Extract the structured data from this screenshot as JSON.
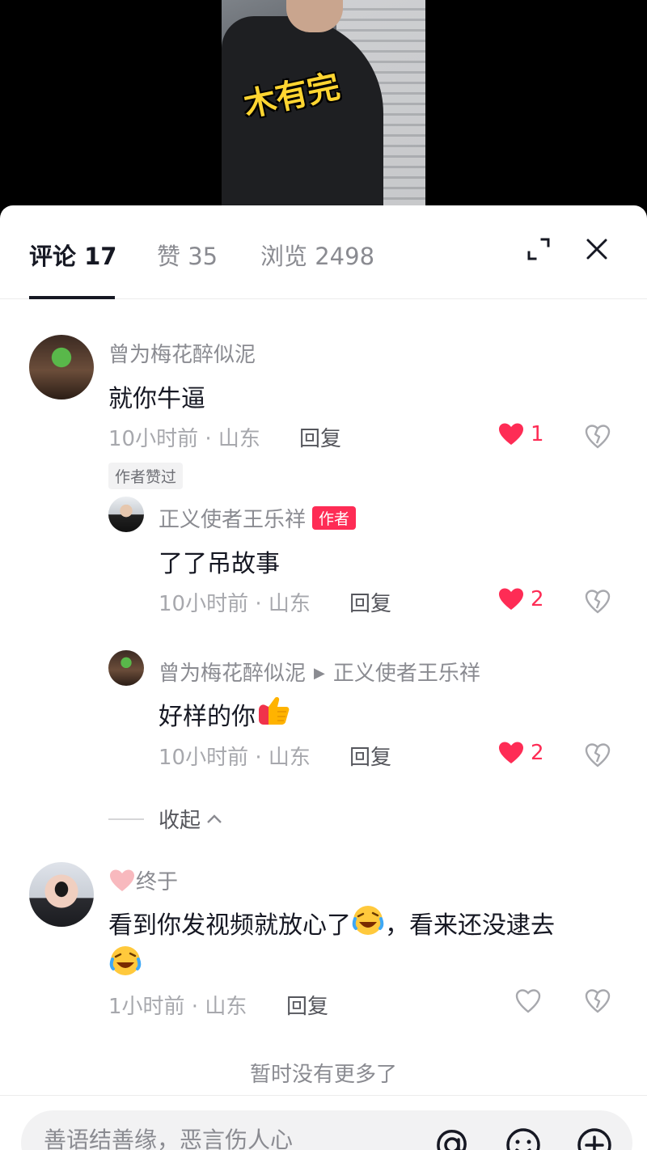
{
  "video": {
    "caption": "木有完"
  },
  "tabs": [
    {
      "label": "评论 17"
    },
    {
      "label": "赞 35"
    },
    {
      "label": "浏览 2498"
    }
  ],
  "comments": [
    {
      "username": "曾为梅花醉似泥",
      "text": "就你牛逼",
      "time_location": "10小时前 · 山东",
      "reply_label": "回复",
      "likes": "1",
      "liked": true,
      "badge": "作者赞过",
      "replies": [
        {
          "username": "正义使者王乐祥",
          "author_badge": "作者",
          "text": "了了吊故事",
          "time_location": "10小时前 · 山东",
          "reply_label": "回复",
          "likes": "2",
          "liked": true
        },
        {
          "username": "曾为梅花醉似泥",
          "reply_to": "正义使者王乐祥",
          "text": "好样的你",
          "emoji": "thumbs-up",
          "time_location": "10小时前 · 山东",
          "reply_label": "回复",
          "likes": "2",
          "liked": true
        }
      ],
      "collapse_label": "收起"
    },
    {
      "username": "终于",
      "username_prefix_icon": "pink-heart-icon",
      "text_part1": "看到你发视频就放心了",
      "text_part2": "，看来还没逮去",
      "emoji": "rolling-laughing",
      "time_location": "1小时前 · 山东",
      "reply_label": "回复",
      "liked": false
    }
  ],
  "end_text": "暂时没有更多了",
  "input": {
    "placeholder": "善语结善缘，恶言伤人心"
  },
  "colors": {
    "like_red": "#fe2c55",
    "text_primary": "#161823",
    "text_secondary": "#8a8b91"
  }
}
